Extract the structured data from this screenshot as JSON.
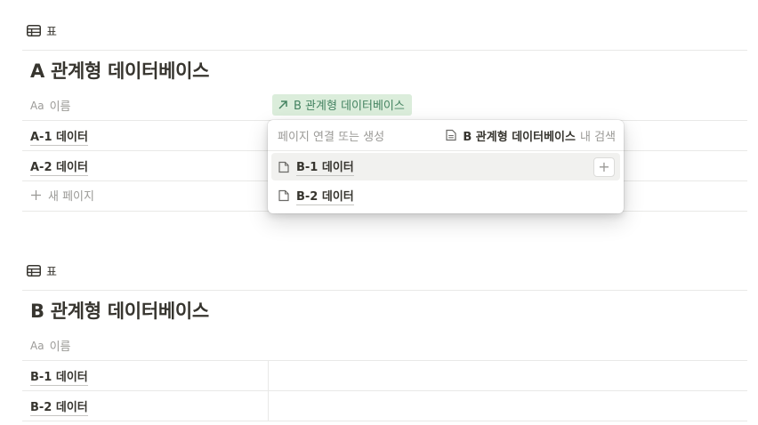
{
  "db_a": {
    "view_label": "표",
    "title": "A 관계형 데이터베이스",
    "name_prefix": "Aa",
    "name_header": "이름",
    "relation_header": "B 관계형 데이터베이스",
    "rows": [
      "A-1 데이터",
      "A-2 데이터"
    ],
    "new_page": "새 페이지"
  },
  "popup": {
    "placeholder": "페이지 연결 또는 생성",
    "search_db": "B 관계형 데이터베이스",
    "search_suffix": "내 검색",
    "items": [
      "B-1 데이터",
      "B-2 데이터"
    ],
    "plus": "+"
  },
  "db_b": {
    "view_label": "표",
    "title": "B 관계형 데이터베이스",
    "name_prefix": "Aa",
    "name_header": "이름",
    "rows": [
      "B-1 데이터",
      "B-2 데이터"
    ]
  },
  "colors": {
    "relation_bg": "#dbeddb",
    "relation_text": "#448361",
    "text": "#37352f",
    "muted": "#9b9a97"
  }
}
